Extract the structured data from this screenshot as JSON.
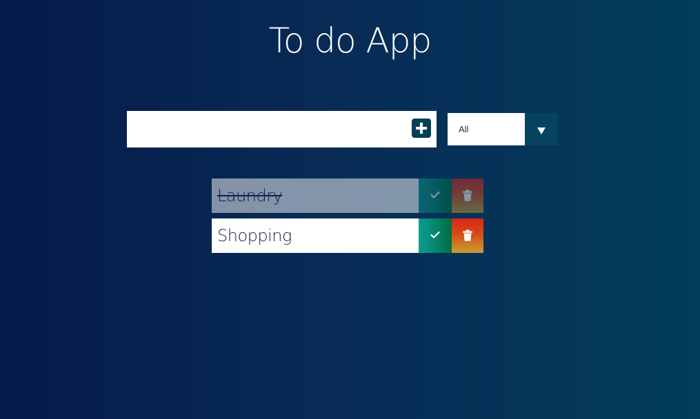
{
  "header": {
    "title": "To do App"
  },
  "form": {
    "input_value": "",
    "filter": {
      "selected": "All"
    }
  },
  "todos": [
    {
      "text": "Laundry",
      "completed": true
    },
    {
      "text": "Shopping",
      "completed": false
    }
  ],
  "colors": {
    "background_start": "#061b4a",
    "background_end": "#023d5c",
    "add_button": "#04405a",
    "check_button": "#0a9c91",
    "trash_button": "#d6251a"
  },
  "icons": {
    "add": "plus-icon",
    "filter_arrow": "triangle-down-icon",
    "complete": "check-icon",
    "delete": "trash-icon"
  }
}
